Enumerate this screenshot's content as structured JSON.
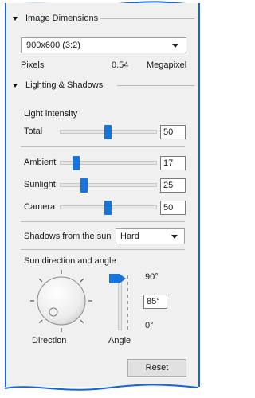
{
  "image_dimensions": {
    "header": "Image Dimensions",
    "size_select": "900x600 (3:2)",
    "pixels_label": "Pixels",
    "megapixel_value": "0.54",
    "megapixel_label": "Megapixel"
  },
  "lighting": {
    "header": "Lighting & Shadows",
    "light_intensity_label": "Light intensity",
    "total": {
      "label": "Total",
      "value": "50",
      "level": 0.5
    },
    "ambient": {
      "label": "Ambient",
      "value": "17",
      "level": 0.17
    },
    "sunlight": {
      "label": "Sunlight",
      "value": "25",
      "level": 0.25
    },
    "camera": {
      "label": "Camera",
      "value": "50",
      "level": 0.5
    },
    "shadows_label": "Shadows from the sun",
    "shadows_value": "Hard",
    "sun_direction_label": "Sun direction and angle",
    "angle_max": "90°",
    "angle_min": "0°",
    "angle_value": "85°",
    "angle_level": 0.944,
    "direction_label": "Direction",
    "angle_label": "Angle",
    "reset_label": "Reset"
  },
  "colors": {
    "accent": "#1a73d9",
    "panel_bg": "#f0f0f0",
    "border": "#1565d8"
  }
}
